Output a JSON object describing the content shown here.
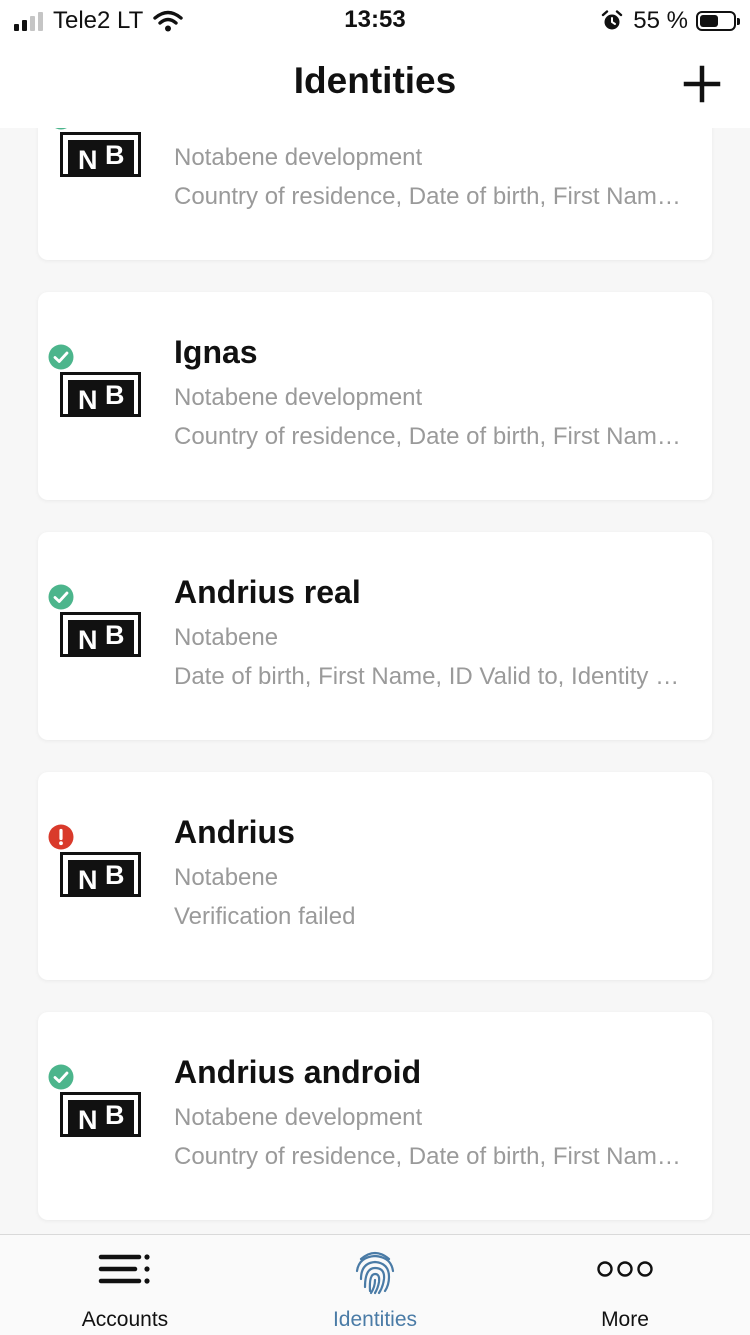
{
  "status_bar": {
    "carrier": "Tele2 LT",
    "time": "13:53",
    "battery_percent": "55 %",
    "battery_level": 0.55
  },
  "header": {
    "title": "Identities",
    "add_icon": "plus-icon"
  },
  "identities": [
    {
      "name": "",
      "issuer": "Notabene development",
      "attributes": "Country of residence, Date of birth, First Name, ID Valid to",
      "status": "verified",
      "logo": "NB"
    },
    {
      "name": "Ignas",
      "issuer": "Notabene development",
      "attributes": "Country of residence, Date of birth, First Name, ID Valid to",
      "status": "verified",
      "logo": "NB"
    },
    {
      "name": "Andrius real",
      "issuer": "Notabene",
      "attributes": "Date of birth, First Name, ID Valid to, Identity number",
      "status": "verified",
      "logo": "NB"
    },
    {
      "name": "Andrius",
      "issuer": "Notabene",
      "attributes": "Verification failed",
      "status": "failed",
      "logo": "NB"
    },
    {
      "name": "Andrius android",
      "issuer": "Notabene development",
      "attributes": "Country of residence, Date of birth, First Name, ID Valid to",
      "status": "verified",
      "logo": "NB"
    }
  ],
  "tabs": [
    {
      "label": "Accounts",
      "icon": "accounts-menu-icon",
      "active": false
    },
    {
      "label": "Identities",
      "icon": "fingerprint-icon",
      "active": true
    },
    {
      "label": "More",
      "icon": "more-dots-icon",
      "active": false
    }
  ],
  "colors": {
    "verified": "#4cb58c",
    "failed": "#d93a2b",
    "active_tab": "#4a7ba6",
    "secondary_text": "#9a9a9a"
  }
}
